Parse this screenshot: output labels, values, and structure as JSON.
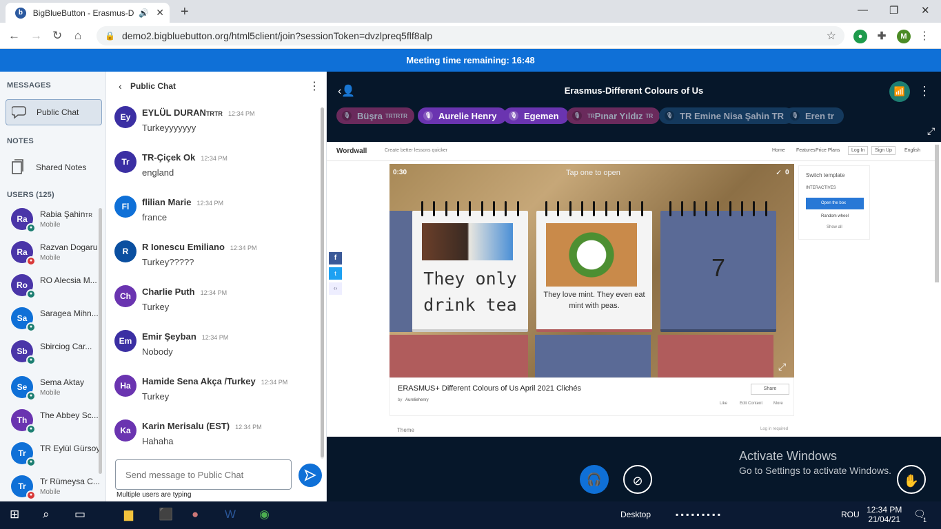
{
  "browser": {
    "tab_title": "BigBlueButton - Erasmus-Diff",
    "url": "demo2.bigbluebutton.org/html5client/join?sessionToken=dvzlpreq5flf8alp",
    "profile_initial": "M"
  },
  "banner": {
    "text": "Meeting time remaining: 16:48"
  },
  "sidebar": {
    "messages_header": "MESSAGES",
    "public_chat": "Public Chat",
    "notes_header": "NOTES",
    "shared_notes": "Shared Notes",
    "users_header": "USERS (125)",
    "users": [
      {
        "initials": "Ra",
        "name": "Rabia Şahin",
        "suffix": "TR",
        "sub": "Mobile",
        "color": "#4a35a8",
        "badge": "#1d7f72"
      },
      {
        "initials": "Ra",
        "name": "Razvan Dogaru",
        "sub": "Mobile",
        "color": "#4a35a8",
        "badge": "#d93a3a"
      },
      {
        "initials": "Ro",
        "name": "RO Alecsia M...",
        "sub": "",
        "color": "#4a35a8",
        "badge": "#1d7f72"
      },
      {
        "initials": "Sa",
        "name": "Saragea Mihn...",
        "sub": "",
        "color": "#0f70d7",
        "badge": "#1d7f72"
      },
      {
        "initials": "Sb",
        "name": "Sbirciog Car...",
        "sub": "",
        "color": "#4a35a8",
        "badge": "#1d7f72"
      },
      {
        "initials": "Se",
        "name": "Sema Aktay",
        "sub": "Mobile",
        "color": "#0f70d7",
        "badge": "#1d7f72"
      },
      {
        "initials": "Th",
        "name": "The Abbey Sc...",
        "sub": "",
        "color": "#6a34b0",
        "badge": "#1d7f72"
      },
      {
        "initials": "Tr",
        "name": "TR Eylül Gürsoy",
        "sub": "",
        "color": "#0f70d7",
        "badge": "#1d7f72"
      },
      {
        "initials": "Tr",
        "name": "Tr Rümeysa C...",
        "sub": "Mobile",
        "color": "#0f70d7",
        "badge": "#d93a3a"
      }
    ]
  },
  "chat": {
    "title": "Public Chat",
    "messages": [
      {
        "initials": "Ey",
        "name": "EYLÜL DURAN",
        "suffix": "TRTR",
        "time": "12:34 PM",
        "text": "Turkeyyyyyyy",
        "color": "#3b2fa3"
      },
      {
        "initials": "Tr",
        "name": "TR-Çiçek Ok",
        "time": "12:34 PM",
        "text": "england",
        "color": "#3b2fa3"
      },
      {
        "initials": "Fl",
        "name": "flilian Marie",
        "time": "12:34 PM",
        "text": "france",
        "color": "#0f70d7"
      },
      {
        "initials": "R",
        "name": "R Ionescu Emiliano",
        "time": "12:34 PM",
        "text": "Turkey?????",
        "color": "#0a4fa0"
      },
      {
        "initials": "Ch",
        "name": "Charlie Puth",
        "time": "12:34 PM",
        "text": "Turkey",
        "color": "#6a34b0"
      },
      {
        "initials": "Em",
        "name": "Emir Şeyban",
        "time": "12:34 PM",
        "text": "Nobody",
        "color": "#3b2fa3"
      },
      {
        "initials": "Ha",
        "name": "Hamide Sena Akça /Turkey",
        "time": "12:34 PM",
        "text": "Turkey",
        "color": "#6a34b0"
      },
      {
        "initials": "Ka",
        "name": "Karin Merisalu (EST)",
        "time": "12:34 PM",
        "text": "Hahaha",
        "color": "#6a34b0"
      }
    ],
    "input_placeholder": "Send message to Public Chat",
    "typing": "Multiple users are typing"
  },
  "main": {
    "title": "Erasmus-Different Colours of Us",
    "talkers": [
      {
        "name": "Büşra",
        "suffix": "TRTRTR",
        "color": "#6a2a5c",
        "active": false
      },
      {
        "name": "Aurelie Henry",
        "color": "#6a34b0",
        "active": true
      },
      {
        "name": "Egemen",
        "color": "#6a34b0",
        "active": true
      },
      {
        "name": "Pınar Yıldız",
        "prefix": "TR",
        "suffix": "TR",
        "color": "#6a2a5c",
        "active": false
      },
      {
        "name": "TR Emine Nisa Şahin TR",
        "color": "#14395d",
        "active": false
      },
      {
        "name": "Eren tr",
        "color": "#14395d",
        "active": false
      }
    ]
  },
  "wordwall": {
    "logo": "Wordwall",
    "tagline": "Create better lessons quicker",
    "nav": [
      "Home",
      "Features",
      "Price Plans",
      "Log In",
      "Sign Up",
      "English"
    ],
    "timer": "0:30",
    "prompt": "Tap one to open",
    "score": "0",
    "card1_text": "They only drink tea",
    "card2_text": "They love mint. They even eat mint with peas.",
    "card3_number": "7",
    "switch_template": "Switch template",
    "interactives": "INTERACTIVES",
    "options": [
      "Open the box",
      "Random wheel"
    ],
    "show_all": "Show all",
    "activity_title": "ERASMUS+ Different Colours of Us April 2021 Clichés",
    "by": "by",
    "author": "Aureliehenry",
    "share": "Share",
    "like": "Like",
    "edit": "Edit Content",
    "more": "More",
    "theme": "Theme",
    "login_req": "Log in required"
  },
  "activate": {
    "title": "Activate Windows",
    "sub": "Go to Settings to activate Windows."
  },
  "taskbar": {
    "desktop": "Desktop",
    "lang": "ROU",
    "time": "12:34 PM",
    "date": "21/04/21",
    "notif": "1"
  }
}
